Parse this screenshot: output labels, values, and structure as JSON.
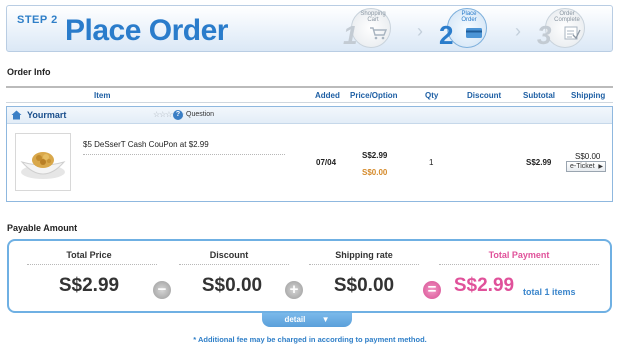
{
  "header": {
    "step_label": "STEP 2",
    "title": "Place Order",
    "steps": [
      {
        "num": "1",
        "label": "Shopping Cart",
        "icon": "cart-icon",
        "active": false
      },
      {
        "num": "2",
        "label": "Place Order",
        "icon": "card-icon",
        "active": true
      },
      {
        "num": "3",
        "label": "Order Complete",
        "icon": "checklist-icon",
        "active": false
      }
    ]
  },
  "order_info": {
    "heading": "Order Info",
    "columns": [
      "Item",
      "Added",
      "Price/Option",
      "Qty",
      "Discount",
      "Subtotal",
      "Shipping"
    ],
    "seller": {
      "name": "Yourmart",
      "rating": "☆☆☆☆☆",
      "question_label": "Question"
    },
    "row": {
      "item_name": "$5 DeSserT Cash CouPon at $2.99",
      "added": "07/04",
      "price": "S$2.99",
      "option": "S$0.00",
      "qty": "1",
      "discount": "",
      "subtotal": "S$2.99",
      "shipping": "S$0.00",
      "shipping_method": "e-Ticket"
    }
  },
  "payable": {
    "heading": "Payable Amount",
    "total_price_label": "Total Price",
    "total_price": "S$2.99",
    "discount_label": "Discount",
    "discount": "S$0.00",
    "shipping_label": "Shipping rate",
    "shipping": "S$0.00",
    "total_payment_label": "Total Payment",
    "total_payment": "S$2.99",
    "total_items": "total 1 items",
    "minus": "−",
    "plus": "+",
    "equals": "="
  },
  "detail_label": "detail",
  "note": "* Additional fee may be charged in according to payment method.",
  "colors": {
    "accent": "#2a7ccb",
    "pink": "#e0519a",
    "border": "#6fb0e3"
  }
}
